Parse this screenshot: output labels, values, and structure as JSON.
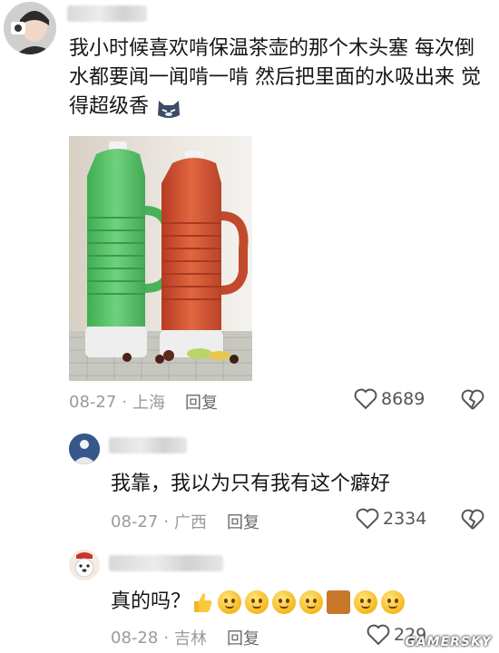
{
  "comment_main": {
    "text": "我小时候喜欢啃保温茶壶的那个木头塞  每次倒水都要闻一闻啃一啃  然后把里面的水吸出来  觉得超级香",
    "date": "08-27",
    "location": "上海",
    "reply_label": "回复",
    "like_count": "8689"
  },
  "reply_1": {
    "text": "我靠，我以为只有我有这个癖好",
    "date": "08-27",
    "location": "广西",
    "reply_label": "回复",
    "like_count": "2334"
  },
  "reply_2": {
    "text": "真的吗？",
    "date": "08-28",
    "location": "吉林",
    "reply_label": "回复",
    "like_count": "229"
  },
  "separator": "·",
  "watermark": "GAMERSKY",
  "colors": {
    "green_flask": "#5cc46a",
    "red_flask": "#d5502f",
    "meta_gray": "#9a9a9a"
  }
}
